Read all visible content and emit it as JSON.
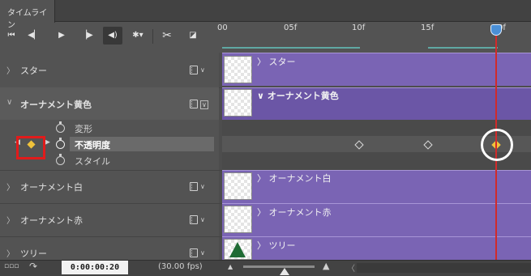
{
  "panel": {
    "tab_label": "タイムライン"
  },
  "transport": {
    "icons": [
      "go-to-first-frame-icon",
      "previous-frame-icon",
      "play-icon",
      "next-frame-icon",
      "audio-icon",
      "settings-icon",
      "split-icon",
      "transition-icon"
    ]
  },
  "ruler": {
    "labels": [
      "00",
      "05f",
      "10f",
      "15f",
      "0f"
    ]
  },
  "layers": [
    {
      "name": "スター",
      "expanded": false
    },
    {
      "name": "オーナメント黄色",
      "expanded": true,
      "properties": [
        "変形",
        "不透明度",
        "スタイル"
      ],
      "selected_property": "不透明度"
    },
    {
      "name": "オーナメント白",
      "expanded": false
    },
    {
      "name": "オーナメント赤",
      "expanded": false
    },
    {
      "name": "ツリー",
      "expanded": false
    }
  ],
  "clips": [
    {
      "label": "スター"
    },
    {
      "label": "オーナメント黄色"
    },
    {
      "label": "オーナメント白"
    },
    {
      "label": "オーナメント赤"
    },
    {
      "label": "ツリー"
    }
  ],
  "keyframes_frames": [
    10,
    15,
    20
  ],
  "status": {
    "timecode": "0:00:00:20",
    "fps": "(30.00 fps)"
  },
  "colors": {
    "clip": "#7a64b4",
    "playhead": "#d12a2a",
    "keyframe_selected": "#f0c23a",
    "annotation_box": "#e11b1b"
  }
}
